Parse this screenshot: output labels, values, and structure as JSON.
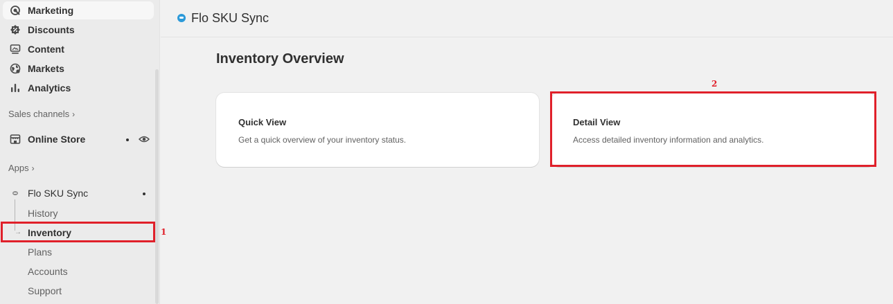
{
  "sidebar": {
    "items": [
      {
        "label": "Marketing",
        "icon": "target-icon"
      },
      {
        "label": "Discounts",
        "icon": "discount-icon"
      },
      {
        "label": "Content",
        "icon": "content-icon"
      },
      {
        "label": "Markets",
        "icon": "globe-icon"
      },
      {
        "label": "Analytics",
        "icon": "bar-chart-icon"
      }
    ],
    "sales_channels_label": "Sales channels",
    "online_store_label": "Online Store",
    "apps_label": "Apps",
    "app_name": "Flo SKU Sync",
    "app_subitems": [
      "History",
      "Inventory",
      "Plans",
      "Accounts",
      "Support"
    ]
  },
  "topbar": {
    "title": "Flo SKU Sync"
  },
  "main": {
    "page_title": "Inventory Overview",
    "cards": [
      {
        "title": "Quick View",
        "description": "Get a quick overview of your inventory status."
      },
      {
        "title": "Detail View",
        "description": "Access detailed inventory information and analytics."
      }
    ]
  },
  "annotations": [
    "1",
    "2"
  ],
  "colors": {
    "annotation": "#e0202a",
    "accent": "#2c9ad9"
  }
}
